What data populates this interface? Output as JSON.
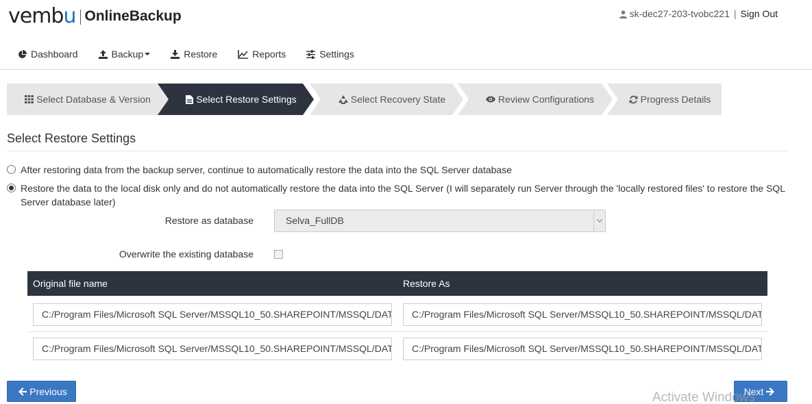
{
  "brand": {
    "name_pre": "vemb",
    "name_u": "u",
    "product": "OnlineBackup"
  },
  "user": {
    "name": "sk-dec27-203-tvobc221",
    "separator": "|",
    "signout": "Sign Out"
  },
  "nav": [
    {
      "label": "Dashboard",
      "icon": "pie-chart-icon"
    },
    {
      "label": "Backup",
      "icon": "upload-icon"
    },
    {
      "label": "Restore",
      "icon": "download-icon"
    },
    {
      "label": "Reports",
      "icon": "line-chart-icon"
    },
    {
      "label": "Settings",
      "icon": "sliders-icon"
    }
  ],
  "wizard": {
    "steps": [
      {
        "label": "Select Database & Version",
        "icon": "grid-icon",
        "active": false
      },
      {
        "label": "Select Restore Settings",
        "icon": "file-icon",
        "active": true
      },
      {
        "label": "Select Recovery State",
        "icon": "recycle-icon",
        "active": false
      },
      {
        "label": "Review Configurations",
        "icon": "eye-icon",
        "active": false
      },
      {
        "label": "Progress Details",
        "icon": "refresh-icon",
        "active": false
      }
    ]
  },
  "page": {
    "title": "Select Restore Settings",
    "options": [
      {
        "label": "After restoring data from the backup server, continue to automatically restore the data into the SQL Server database",
        "checked": false
      },
      {
        "label_line1": "Restore the data to the local disk only and do not automatically restore the data into the SQL Server (I will separately run Server through the 'locally restored files' to restore the SQL",
        "label_line2": "Server database later)",
        "checked": true
      }
    ],
    "restore_as_label": "Restore as database",
    "restore_as_value": "Selva_FullDB",
    "overwrite_label": "Overwrite the existing database",
    "overwrite_checked": false
  },
  "table": {
    "headers": [
      "Original file name",
      "Restore As"
    ],
    "rows": [
      {
        "original": "C:/Program Files/Microsoft SQL Server/MSSQL10_50.SHAREPOINT/MSSQL/DAT",
        "restore_as": "C:/Program Files/Microsoft SQL Server/MSSQL10_50.SHAREPOINT/MSSQL/DAT"
      },
      {
        "original": "C:/Program Files/Microsoft SQL Server/MSSQL10_50.SHAREPOINT/MSSQL/DAT",
        "restore_as": "C:/Program Files/Microsoft SQL Server/MSSQL10_50.SHAREPOINT/MSSQL/DAT"
      }
    ]
  },
  "buttons": {
    "previous": "Previous",
    "next": "Next"
  },
  "watermark": "Activate Windows",
  "colors": {
    "accent": "#3a78c3",
    "dark": "#2d3440",
    "step_bg": "#e6e6e6",
    "logo_u": "#1e6fbf"
  }
}
